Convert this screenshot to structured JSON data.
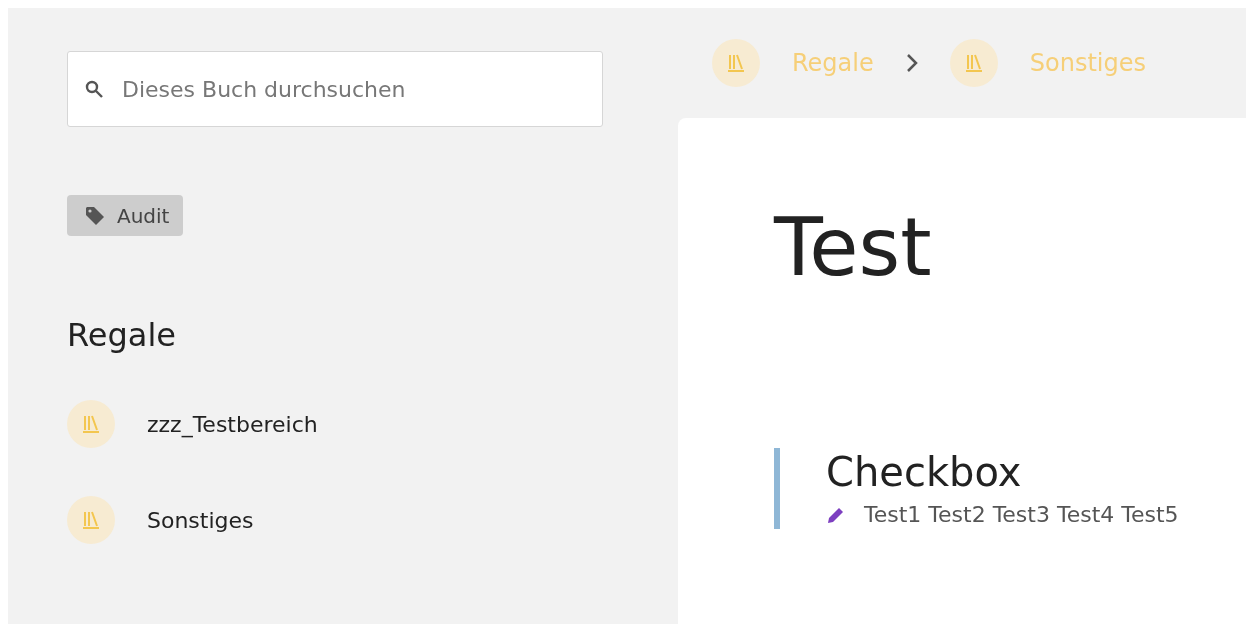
{
  "search": {
    "placeholder": "Dieses Buch durchsuchen"
  },
  "tags": [
    {
      "label": "Audit"
    }
  ],
  "shelves": {
    "heading": "Regale",
    "items": [
      {
        "label": "zzz_Testbereich"
      },
      {
        "label": "Sonstiges"
      }
    ]
  },
  "breadcrumb": [
    {
      "label": "Regale"
    },
    {
      "label": "Sonstiges"
    }
  ],
  "page": {
    "title": "Test",
    "sections": [
      {
        "title": "Checkbox",
        "text": "Test1 Test2 Test3 Test4 Test5"
      }
    ]
  }
}
